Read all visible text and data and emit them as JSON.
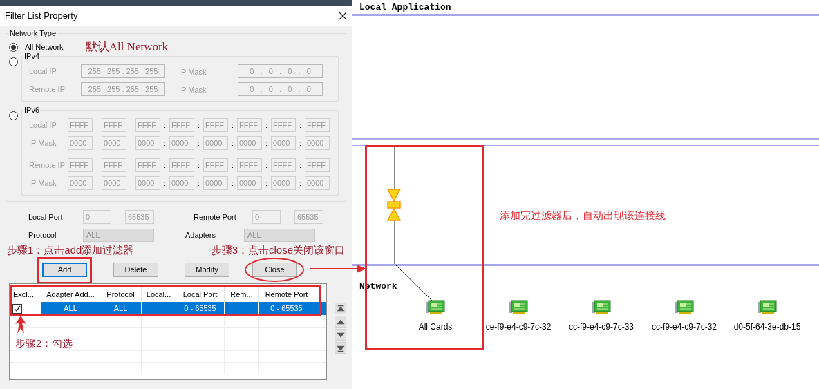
{
  "dialog": {
    "title": "Filter List Property",
    "network_type": {
      "label": "Network Type",
      "options": [
        {
          "label": "All Network",
          "selected": true
        },
        {
          "label": "IPv4",
          "selected": false
        },
        {
          "label": "IPv6",
          "selected": false
        }
      ]
    },
    "ipv4": {
      "disabled": true,
      "rows": [
        {
          "label": "Local IP",
          "value": "255 . 255 . 255 . 255",
          "mask_label": "IP Mask",
          "mask": "0   .   0   .   0   .   0"
        },
        {
          "label": "Remote IP",
          "value": "255 . 255 . 255 . 255",
          "mask_label": "IP Mask",
          "mask": "0   .   0   .   0   .   0"
        }
      ]
    },
    "ipv6": {
      "disabled": true,
      "separator": ":",
      "rows": [
        {
          "label": "Local IP",
          "groups": [
            "FFFF",
            "FFFF",
            "FFFF",
            "FFFF",
            "FFFF",
            "FFFF",
            "FFFF",
            "FFFF"
          ]
        },
        {
          "label": "IP Mask",
          "groups": [
            "0000",
            "0000",
            "0000",
            "0000",
            "0000",
            "0000",
            "0000",
            "0000"
          ]
        },
        {
          "label": "Remote IP",
          "groups": [
            "FFFF",
            "FFFF",
            "FFFF",
            "FFFF",
            "FFFF",
            "FFFF",
            "FFFF",
            "FFFF"
          ]
        },
        {
          "label": "IP Mask",
          "groups": [
            "0000",
            "0000",
            "0000",
            "0000",
            "0000",
            "0000",
            "0000",
            "0000"
          ]
        }
      ]
    },
    "ports": [
      {
        "label": "Local Port",
        "from": "0",
        "dash": "-",
        "to": "65535"
      },
      {
        "label": "Remote Port",
        "from": "0",
        "dash": "-",
        "to": "65535"
      }
    ],
    "selects": [
      {
        "label": "Protocol",
        "value": "ALL"
      },
      {
        "label": "Adapters",
        "value": "ALL"
      }
    ],
    "buttons": [
      {
        "label": "Add",
        "focused": true
      },
      {
        "label": "Delete",
        "focused": false
      },
      {
        "label": "Modify",
        "focused": false
      },
      {
        "label": "Close",
        "focused": false
      }
    ],
    "table": {
      "columns": [
        "Excl...",
        "Adapter Add...",
        "Protocol",
        "Local...",
        "Local Port",
        "Rem...",
        "Remote Port"
      ],
      "rows": [
        {
          "checked": true,
          "selected": true,
          "cells": [
            "",
            "ALL",
            "ALL",
            "",
            "0 - 65535",
            "",
            "0 - 65535"
          ]
        }
      ]
    }
  },
  "diagram": {
    "lanes": [
      {
        "title": "Local Application"
      },
      {
        "title": "Network"
      }
    ],
    "cards": [
      {
        "label": "All Cards"
      },
      {
        "label": "ce-f9-e4-c9-7c-32"
      },
      {
        "label": "cc-f9-e4-c9-7c-33"
      },
      {
        "label": "cc-f9-e4-c9-7c-32"
      },
      {
        "label": "d0-5f-64-3e-db-15"
      }
    ]
  },
  "annotations": {
    "network_type": "默认All Network",
    "step1": "步骤1：点击add添加过滤器",
    "step2": "步骤2：勾选",
    "step3": "步骤3：点击close关闭该窗口",
    "diagram": "添加完过滤器后，自动出现该连接线"
  }
}
